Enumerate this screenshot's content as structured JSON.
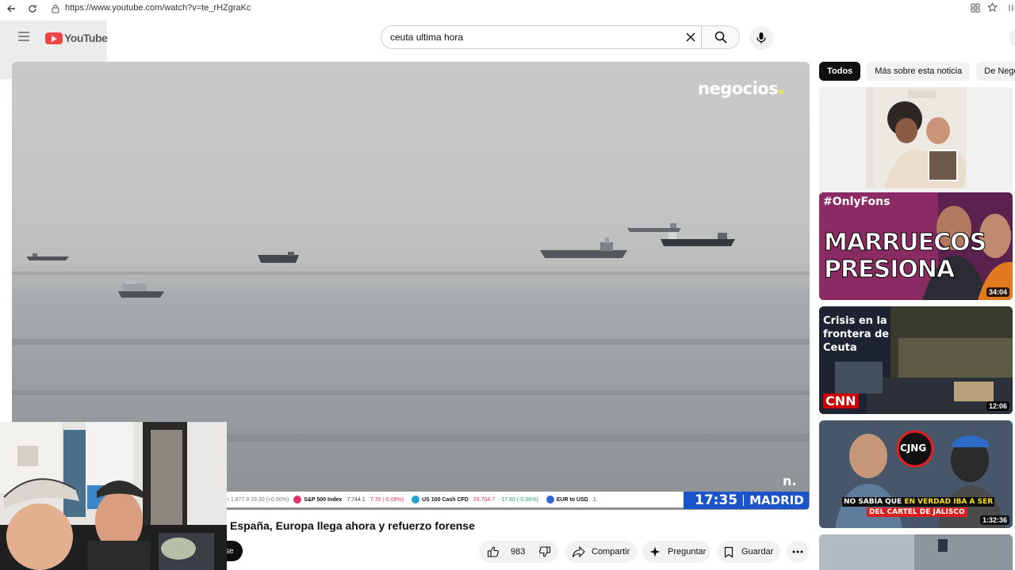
{
  "browser": {
    "url": "https://www.youtube.com/watch?v=te_rHZgraKc"
  },
  "header": {
    "logo_text": "YouTube",
    "search_value": "ceuta ultima hora"
  },
  "player": {
    "watermark": "negocios",
    "corner_logo": "n.",
    "ticker": [
      {
        "name": "S&P 500 Index",
        "value": "7,744.1",
        "change": "7.70 (-0.09%)",
        "color": "#e0306b"
      },
      {
        "name": "US 100 Cash CFD",
        "value": "29,704.7",
        "change": "-17.60 (-0.06%)",
        "color": "#1fa36a"
      },
      {
        "name": "EUR to USD",
        "value": "1.",
        "change": "",
        "color": "#2b68d6"
      }
    ],
    "ticker_lead": "n  1,877.8  19.30 (+0.50%)",
    "clock_time": "17:35",
    "clock_city": "MADRID"
  },
  "video": {
    "title": "España, Europa llega ahora y refuerzo forense",
    "subscribe_partial": "se",
    "likes": "983",
    "share_label": "Compartir",
    "ask_label": "Preguntar",
    "save_label": "Guardar"
  },
  "sidebar": {
    "chips": [
      "Todos",
      "Más sobre esta noticia",
      "De Negocios"
    ],
    "thumbs": [
      {
        "caption": "",
        "duration": ""
      },
      {
        "caption": "#OnlyFons",
        "caption2": "MARRUECOS",
        "caption3": "PRESIONA",
        "duration": "34:04"
      },
      {
        "caption": "Crisis en la",
        "caption2": "frontera de",
        "caption3": "Ceuta",
        "badge": "CNN",
        "duration": "12:06"
      },
      {
        "caption": "CJNG",
        "caption2": "NO SABÍA QUE",
        "caption2b": "EN VERDAD IBA A SER",
        "caption3": "DEL CARTEL DE JALISCO",
        "duration": "1:32:36"
      }
    ]
  },
  "colors": {
    "accent_red": "#ff0000",
    "clock_blue": "#1b54c8"
  }
}
